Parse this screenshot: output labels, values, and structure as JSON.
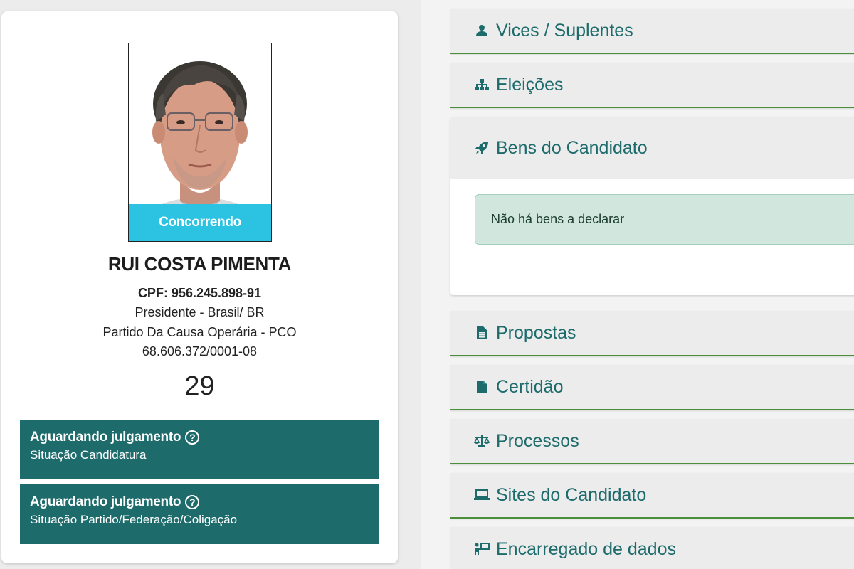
{
  "candidate": {
    "photo_badge": "Concorrendo",
    "name": "RUI COSTA PIMENTA",
    "cpf": "CPF: 956.245.898-91",
    "role": "Presidente - Brasil/ BR",
    "party": "Partido Da Causa Operária - PCO",
    "cnpj": "68.606.372/0001-08",
    "number": "29"
  },
  "statuses": [
    {
      "title": "Aguardando julgamento",
      "subtitle": "Situação Candidatura"
    },
    {
      "title": "Aguardando julgamento",
      "subtitle": "Situação Partido/Federação/Coligação"
    }
  ],
  "help_icon_glyph": "?",
  "accordion": [
    {
      "label": "Vices / Suplentes",
      "icon": "user-icon"
    },
    {
      "label": "Eleições",
      "icon": "sitemap-icon"
    },
    {
      "label": "Bens do Candidato",
      "icon": "rocket-icon",
      "expanded": true,
      "body": "Não há bens a declarar"
    },
    {
      "label": "Propostas",
      "icon": "file-text-icon"
    },
    {
      "label": "Certidão",
      "icon": "file-icon"
    },
    {
      "label": "Processos",
      "icon": "balance-scale-icon"
    },
    {
      "label": "Sites do Candidato",
      "icon": "laptop-icon"
    },
    {
      "label": "Encarregado de dados",
      "icon": "person-chalkboard-icon"
    }
  ],
  "colors": {
    "teal": "#1d6b6b",
    "badge_cyan": "#2cc3e3",
    "green_border": "#4b8f3a",
    "alert_green": "#d1e7dd"
  }
}
